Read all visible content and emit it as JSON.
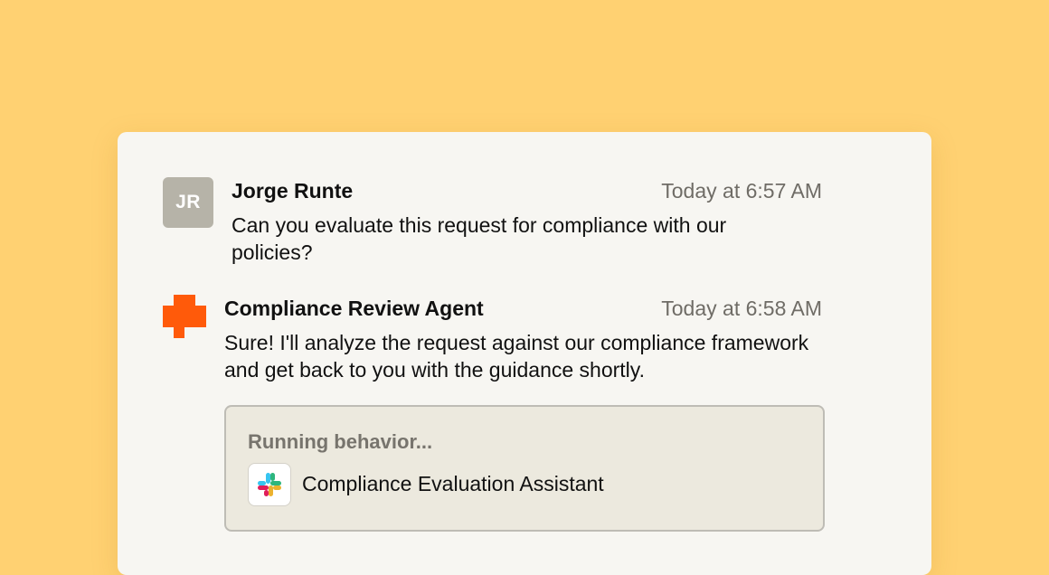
{
  "messages": [
    {
      "avatar_initials": "JR",
      "author": "Jorge Runte",
      "time": "Today at 6:57 AM",
      "text": "Can you evaluate this request for compliance with our policies?"
    },
    {
      "avatar_icon": "agent-logo-icon",
      "author": "Compliance Review Agent",
      "time": "Today at 6:58 AM",
      "text": "Sure! I'll analyze the request against our compliance framework and get back to you with the guidance shortly."
    }
  ],
  "behavior": {
    "status": "Running behavior...",
    "app_icon": "slack-icon",
    "name": "Compliance Evaluation Assistant"
  },
  "colors": {
    "background": "#FFD172",
    "card": "#F7F6F2",
    "agent_brand": "#FF5A0A",
    "avatar": "#B6B3A8",
    "behavior_box": "#ECE9DE"
  }
}
